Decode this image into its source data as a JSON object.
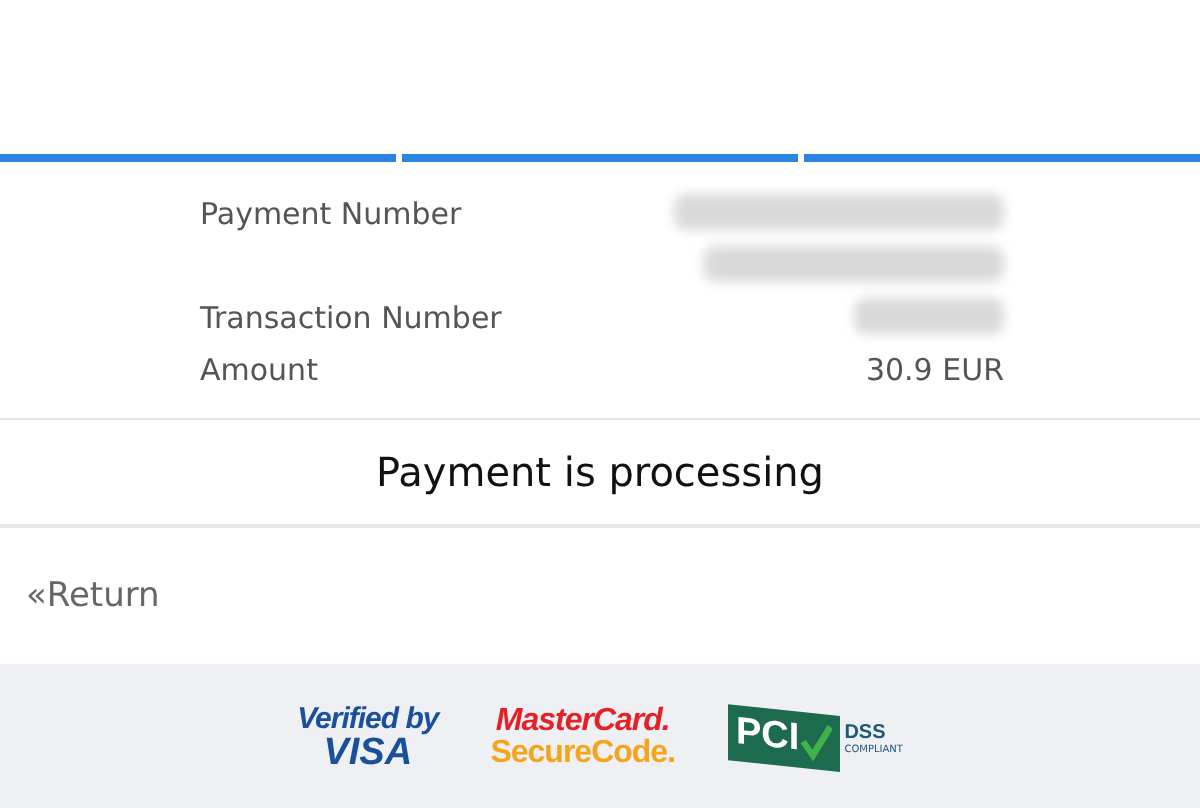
{
  "progress": [
    {
      "done": true
    },
    {
      "done": true
    },
    {
      "done": true
    }
  ],
  "details": [
    {
      "label": "Payment Number",
      "kind": "redacted"
    },
    {
      "kind": "redacted"
    },
    {
      "label": "Transaction Number",
      "kind": "redacted"
    },
    {
      "label": "Amount",
      "kind": "text",
      "value": "30.9 EUR"
    }
  ],
  "status": "Payment is processing",
  "return_link": "«Return",
  "badges": [
    {
      "kind": "visa",
      "lines": [
        "Verified by",
        "VISA"
      ]
    },
    {
      "kind": "mastercard",
      "lines": [
        "MasterCard.",
        "SecureCode."
      ]
    },
    {
      "kind": "pci",
      "lines": [
        "PCI",
        "DSS",
        "COMPLIANT"
      ]
    }
  ]
}
